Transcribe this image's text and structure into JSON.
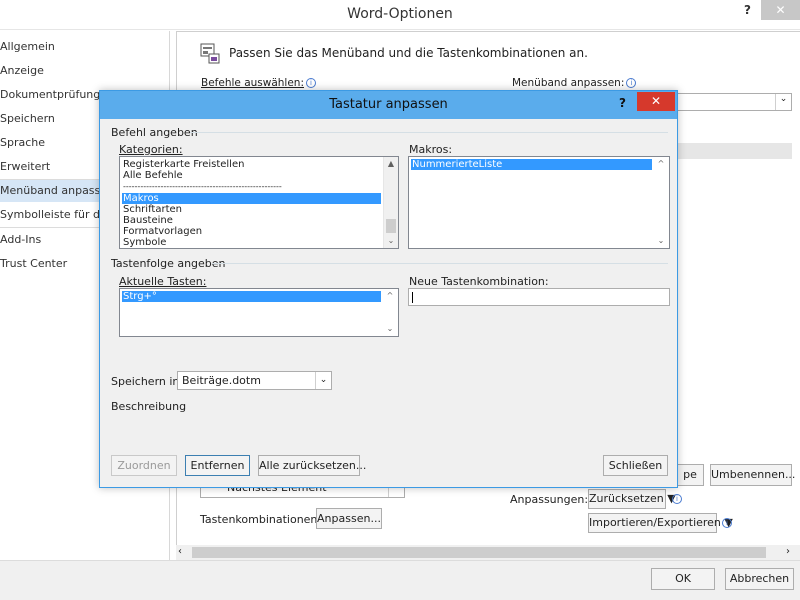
{
  "window": {
    "title": "Word-Optionen",
    "help": "?",
    "close": "✕"
  },
  "nav": {
    "items": [
      {
        "label": "Allgemein"
      },
      {
        "label": "Anzeige"
      },
      {
        "label": "Dokumentprüfung"
      },
      {
        "label": "Speichern"
      },
      {
        "label": "Sprache"
      },
      {
        "label": "Erweitert"
      },
      {
        "label": "Menüband anpassen"
      },
      {
        "label": "Symbolleiste für den Schnellzugriff"
      },
      {
        "label": "Add-Ins"
      },
      {
        "label": "Trust Center"
      }
    ]
  },
  "main": {
    "header": "Passen Sie das Menüband und die Tastenkombinationen an.",
    "choose_commands": "Befehle auswählen:",
    "customize_ribbon": "Menüband anpassen:",
    "next_element": "Nächstes Element",
    "keyboard_shortcuts_label": "Tastenkombinationen:",
    "customize_button": "Anpassen...",
    "group_button_partial": "pe",
    "rename_button": "Umbenennen...",
    "customizations_label": "Anpassungen:",
    "reset_button": "Zurücksetzen ▼",
    "import_export_button": "Importieren/Exportieren ▼"
  },
  "footer": {
    "ok": "OK",
    "cancel": "Abbrechen"
  },
  "dialog": {
    "title": "Tastatur anpassen",
    "help": "?",
    "close": "✕",
    "section_commands": "Befehl angeben",
    "categories_label": "Kategorien:",
    "categories": [
      "Registerkarte Freistellen",
      "Alle Befehle",
      "-------------------------------------------------------",
      "Makros",
      "Schriftarten",
      "Bausteine",
      "Formatvorlagen",
      "Symbole"
    ],
    "categories_selected": "Makros",
    "macros_label": "Makros:",
    "macros": [
      "NummerierteListe"
    ],
    "section_keys": "Tastenfolge angeben",
    "current_keys_label": "Aktuelle Tasten:",
    "current_keys": [
      "Strg+°"
    ],
    "new_shortcut_label": "Neue Tastenkombination:",
    "new_shortcut_value": "",
    "save_in_label": "Speichern in:",
    "save_in_value": "Beiträge.dotm",
    "description_label": "Beschreibung",
    "assign_button": "Zuordnen",
    "remove_button": "Entfernen",
    "reset_all_button": "Alle zurücksetzen...",
    "close_button": "Schließen"
  }
}
